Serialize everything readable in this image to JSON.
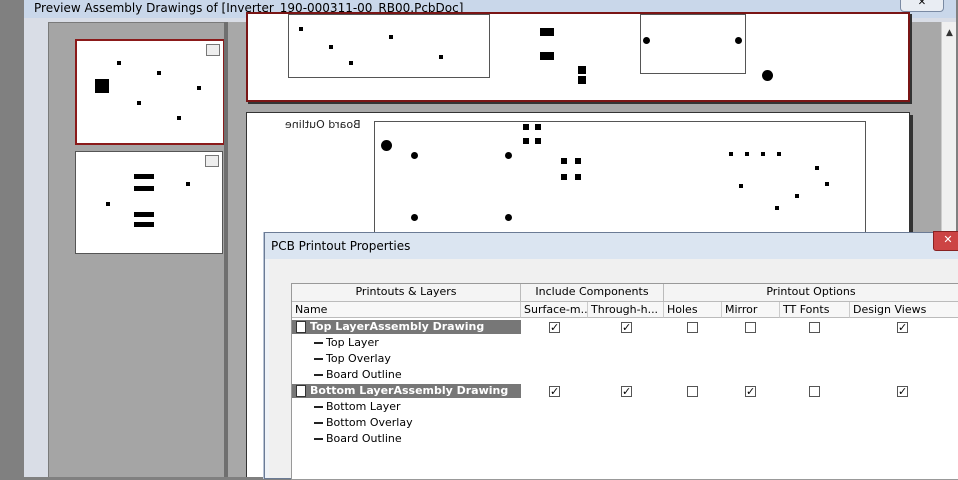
{
  "preview": {
    "title": "Preview Assembly Drawings of [Inverter_190-000311-00_RB00.PcbDoc]",
    "close_label": "✕",
    "board_outline_text": "Board Outline",
    "scroll_up_glyph": "▲",
    "thumbnails": [
      "Top Layer Assembly Drawing thumbnail",
      "Bottom Layer Assembly Drawing thumbnail"
    ]
  },
  "dialog": {
    "title": "PCB Printout Properties",
    "close_label": "✕",
    "header_groups": {
      "printouts_layers": "Printouts & Layers",
      "include_components": "Include Components",
      "printout_options": "Printout Options"
    },
    "columns": [
      "Name",
      "Surface-m...",
      "Through-h...",
      "Holes",
      "Mirror",
      "TT Fonts",
      "Design Views"
    ],
    "printouts": [
      {
        "name": "Top LayerAssembly Drawing",
        "checks": [
          true,
          true,
          false,
          false,
          false,
          true
        ],
        "layers": [
          "Top Layer",
          "Top Overlay",
          "Board Outline"
        ]
      },
      {
        "name": "Bottom LayerAssembly Drawing",
        "checks": [
          true,
          true,
          false,
          true,
          false,
          true
        ],
        "layers": [
          "Bottom Layer",
          "Bottom Overlay",
          "Board Outline"
        ]
      }
    ]
  },
  "colors": {
    "selected_thumb_border": "#8b1a1a",
    "group_row_bg": "#777777",
    "close_button": "#cc4444"
  }
}
